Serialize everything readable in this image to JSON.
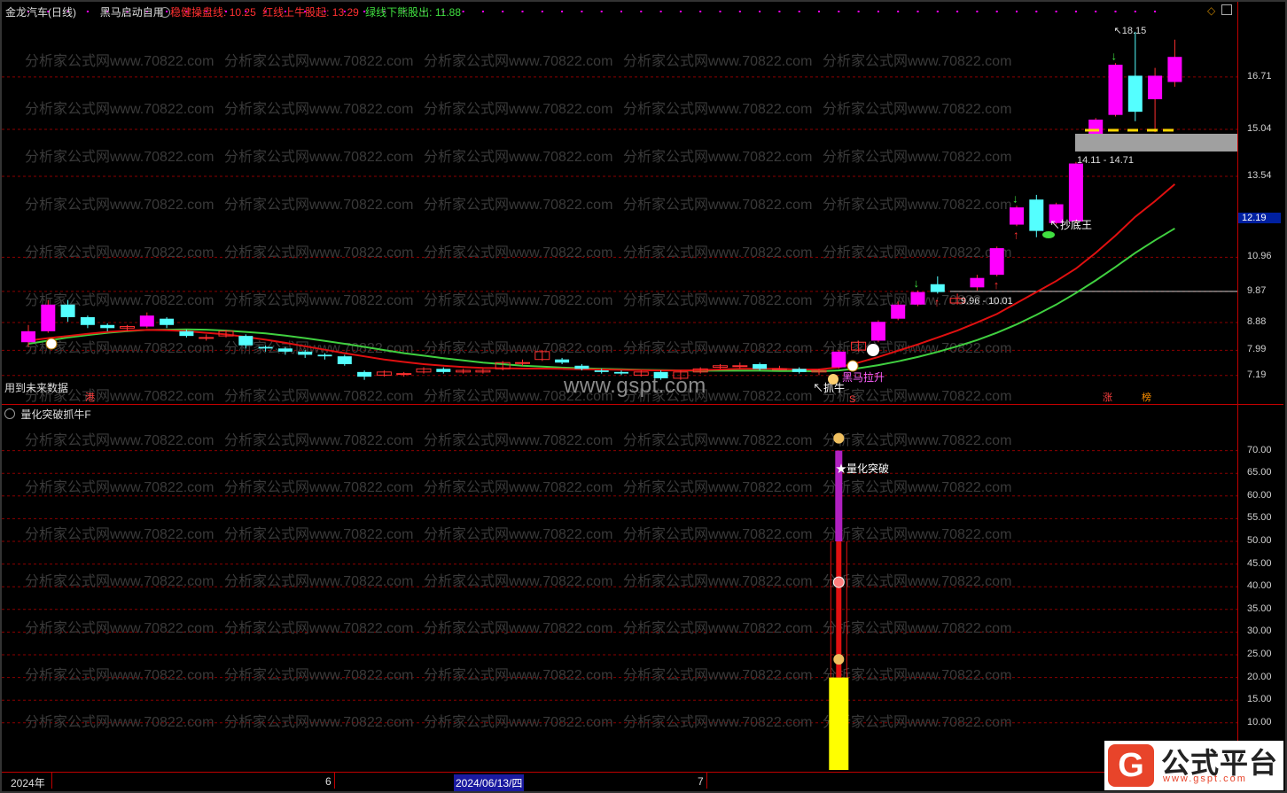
{
  "header": {
    "stock_name": "金龙汽车(日线)",
    "indicator_name": "黑马启动自用",
    "line1_label": "稳健操盘线:",
    "line1_value": "10.25",
    "line2_label": "红线上牛股起:",
    "line2_value": "13.29",
    "line3_label": "绿线下熊股出:",
    "line3_value": "11.88"
  },
  "sub_panel": {
    "title": "量化突破抓牛F"
  },
  "notes": {
    "future_data": "用到未来数据"
  },
  "watermarks": {
    "repeat_text": "分析家公式网www.70822.com",
    "gspt": "www.gspt.com"
  },
  "price_axis": {
    "ticks": [
      "16.71",
      "15.04",
      "13.54",
      "10.96",
      "9.87",
      "8.88",
      "7.99",
      "7.19"
    ],
    "current_price": "12.19"
  },
  "volume_axis": {
    "ticks": [
      "70.00",
      "65.00",
      "60.00",
      "55.00",
      "50.00",
      "45.00",
      "40.00",
      "35.00",
      "30.00",
      "25.00",
      "20.00",
      "15.00",
      "10.00"
    ]
  },
  "annotations": {
    "high": "18.15",
    "range_high": "14.11 - 14.71",
    "range_low": "9.96 - 10.01",
    "chaodi": "↖抄底王",
    "heima": "黑马拉升",
    "zhua_niu": "↖抓牛",
    "liang_hua": "★量化突破",
    "gang": "港",
    "s_mark": "S",
    "zhang": "涨",
    "bang": "榜"
  },
  "time_axis": {
    "year": "2024年",
    "month6": "6",
    "cursor_date": "2024/06/13/四",
    "month7": "7"
  },
  "logo": {
    "badge": "G",
    "text": "公式平台",
    "url": "www.gspt.com"
  },
  "colors": {
    "up_candle": "#ff00ff",
    "down_candle": "#54ffff",
    "red_line": "#e01010",
    "green_line": "#40d040",
    "grid": "#8b0000",
    "axis_text": "#d0d0d0",
    "current_price_bg": "#0020a0"
  },
  "chart_data": {
    "type": "candlestick",
    "price_range": [
      6.9,
      18.6
    ],
    "candles": [
      {
        "o": 8.25,
        "c": 8.6,
        "h": 8.8,
        "l": 8.1
      },
      {
        "o": 8.6,
        "c": 9.45,
        "h": 9.6,
        "l": 8.55
      },
      {
        "o": 9.45,
        "c": 9.05,
        "h": 9.6,
        "l": 8.9
      },
      {
        "o": 9.05,
        "c": 8.8,
        "h": 9.1,
        "l": 8.7
      },
      {
        "o": 8.8,
        "c": 8.7,
        "h": 8.85,
        "l": 8.6
      },
      {
        "o": 8.7,
        "c": 8.75,
        "h": 8.8,
        "l": 8.6
      },
      {
        "o": 8.75,
        "c": 9.1,
        "h": 9.2,
        "l": 8.7
      },
      {
        "o": 9.0,
        "c": 8.8,
        "h": 9.05,
        "l": 8.7
      },
      {
        "o": 8.6,
        "c": 8.45,
        "h": 8.65,
        "l": 8.4
      },
      {
        "o": 8.4,
        "c": 8.4,
        "h": 8.5,
        "l": 8.3
      },
      {
        "o": 8.45,
        "c": 8.6,
        "h": 8.65,
        "l": 8.4
      },
      {
        "o": 8.45,
        "c": 8.15,
        "h": 8.5,
        "l": 8.05
      },
      {
        "o": 8.1,
        "c": 8.05,
        "h": 8.15,
        "l": 7.95
      },
      {
        "o": 8.05,
        "c": 7.95,
        "h": 8.1,
        "l": 7.85
      },
      {
        "o": 7.95,
        "c": 7.85,
        "h": 8.0,
        "l": 7.75
      },
      {
        "o": 7.85,
        "c": 7.8,
        "h": 7.9,
        "l": 7.7
      },
      {
        "o": 7.8,
        "c": 7.55,
        "h": 7.85,
        "l": 7.5
      },
      {
        "o": 7.3,
        "c": 7.15,
        "h": 7.35,
        "l": 7.05
      },
      {
        "o": 7.2,
        "c": 7.3,
        "h": 7.35,
        "l": 7.15
      },
      {
        "o": 7.25,
        "c": 7.25,
        "h": 7.3,
        "l": 7.15
      },
      {
        "o": 7.3,
        "c": 7.4,
        "h": 7.45,
        "l": 7.25
      },
      {
        "o": 7.4,
        "c": 7.3,
        "h": 7.45,
        "l": 7.25
      },
      {
        "o": 7.3,
        "c": 7.35,
        "h": 7.4,
        "l": 7.25
      },
      {
        "o": 7.3,
        "c": 7.35,
        "h": 7.4,
        "l": 7.25
      },
      {
        "o": 7.4,
        "c": 7.6,
        "h": 7.65,
        "l": 7.35
      },
      {
        "o": 7.6,
        "c": 7.6,
        "h": 7.7,
        "l": 7.5
      },
      {
        "o": 7.7,
        "c": 7.95,
        "h": 8.0,
        "l": 7.65
      },
      {
        "o": 7.7,
        "c": 7.6,
        "h": 7.75,
        "l": 7.55
      },
      {
        "o": 7.5,
        "c": 7.4,
        "h": 7.55,
        "l": 7.35
      },
      {
        "o": 7.35,
        "c": 7.3,
        "h": 7.4,
        "l": 7.25
      },
      {
        "o": 7.3,
        "c": 7.25,
        "h": 7.35,
        "l": 7.2
      },
      {
        "o": 7.2,
        "c": 7.3,
        "h": 7.35,
        "l": 7.15
      },
      {
        "o": 7.3,
        "c": 7.1,
        "h": 7.35,
        "l": 7.05
      },
      {
        "o": 7.1,
        "c": 7.3,
        "h": 7.35,
        "l": 7.05
      },
      {
        "o": 7.3,
        "c": 7.4,
        "h": 7.45,
        "l": 7.25
      },
      {
        "o": 7.45,
        "c": 7.5,
        "h": 7.55,
        "l": 7.4
      },
      {
        "o": 7.5,
        "c": 7.5,
        "h": 7.6,
        "l": 7.4
      },
      {
        "o": 7.55,
        "c": 7.4,
        "h": 7.6,
        "l": 7.35
      },
      {
        "o": 7.4,
        "c": 7.4,
        "h": 7.5,
        "l": 7.35
      },
      {
        "o": 7.4,
        "c": 7.3,
        "h": 7.45,
        "l": 7.25
      },
      {
        "o": 7.3,
        "c": 7.35,
        "h": 7.4,
        "l": 7.2
      },
      {
        "o": 7.45,
        "c": 7.95,
        "h": 8.0,
        "l": 7.4
      },
      {
        "o": 8.0,
        "c": 8.25,
        "h": 8.3,
        "l": 7.95
      },
      {
        "o": 8.3,
        "c": 8.9,
        "h": 8.95,
        "l": 8.25
      },
      {
        "o": 9.0,
        "c": 9.45,
        "h": 9.55,
        "l": 8.95
      },
      {
        "o": 9.45,
        "c": 9.85,
        "h": 9.9,
        "l": 9.4
      },
      {
        "o": 10.1,
        "c": 9.85,
        "h": 10.35,
        "l": 9.8
      },
      {
        "o": 9.5,
        "c": 9.65,
        "h": 9.8,
        "l": 9.45
      },
      {
        "o": 10.0,
        "c": 10.3,
        "h": 10.4,
        "l": 9.9
      },
      {
        "o": 10.4,
        "c": 11.25,
        "h": 11.3,
        "l": 10.35
      },
      {
        "o": 12.0,
        "c": 12.55,
        "h": 12.6,
        "l": 11.95
      },
      {
        "o": 12.8,
        "c": 11.8,
        "h": 12.95,
        "l": 11.6
      },
      {
        "o": 12.05,
        "c": 12.65,
        "h": 12.7,
        "l": 12.0
      },
      {
        "o": 12.1,
        "c": 13.95,
        "h": 14.0,
        "l": 12.05
      },
      {
        "o": 14.75,
        "c": 15.35,
        "h": 15.4,
        "l": 14.7
      },
      {
        "o": 15.5,
        "c": 17.1,
        "h": 17.15,
        "l": 15.45
      },
      {
        "o": 16.75,
        "c": 15.6,
        "h": 18.15,
        "l": 15.3
      },
      {
        "o": 16.0,
        "c": 16.75,
        "h": 17.0,
        "l": 14.95
      },
      {
        "o": 16.55,
        "c": 17.35,
        "h": 17.9,
        "l": 16.4
      }
    ],
    "red_line": [
      8.3,
      8.38,
      8.45,
      8.52,
      8.58,
      8.62,
      8.64,
      8.63,
      8.6,
      8.55,
      8.5,
      8.42,
      8.33,
      8.23,
      8.12,
      8.01,
      7.9,
      7.8,
      7.7,
      7.62,
      7.55,
      7.5,
      7.46,
      7.43,
      7.42,
      7.41,
      7.41,
      7.4,
      7.39,
      7.38,
      7.37,
      7.36,
      7.35,
      7.35,
      7.36,
      7.38,
      7.4,
      7.4,
      7.4,
      7.38,
      7.38,
      7.45,
      7.6,
      7.78,
      7.98,
      8.18,
      8.4,
      8.62,
      8.88,
      9.15,
      9.5,
      9.85,
      10.2,
      10.6,
      11.1,
      11.65,
      12.25,
      12.75,
      13.29
    ],
    "green_line": [
      8.2,
      8.3,
      8.4,
      8.48,
      8.55,
      8.6,
      8.64,
      8.65,
      8.66,
      8.65,
      8.62,
      8.58,
      8.53,
      8.46,
      8.38,
      8.29,
      8.2,
      8.1,
      8.0,
      7.9,
      7.82,
      7.74,
      7.67,
      7.6,
      7.55,
      7.5,
      7.47,
      7.44,
      7.42,
      7.4,
      7.39,
      7.37,
      7.36,
      7.35,
      7.34,
      7.34,
      7.34,
      7.34,
      7.33,
      7.33,
      7.32,
      7.35,
      7.42,
      7.52,
      7.64,
      7.78,
      7.94,
      8.12,
      8.32,
      8.55,
      8.82,
      9.12,
      9.45,
      9.82,
      10.22,
      10.65,
      11.1,
      11.5,
      11.88
    ],
    "horizontal_level": 9.87,
    "volume_bar": {
      "index": 41,
      "yellow": 20.0,
      "red_top": 50.0,
      "magenta_top": 70.0
    }
  }
}
